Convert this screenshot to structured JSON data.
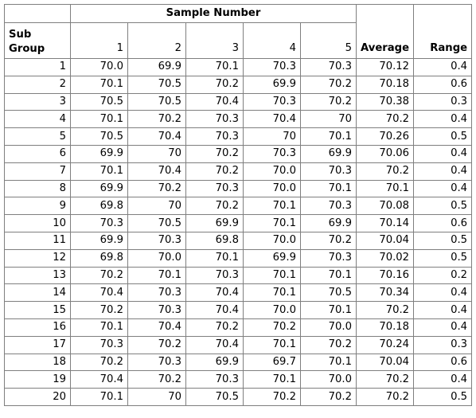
{
  "table": {
    "group_header": "Sample Number",
    "subgroup_header_line1": "Sub",
    "subgroup_header_line2": "Group",
    "sample_columns": [
      "1",
      "2",
      "3",
      "4",
      "5"
    ],
    "average_header": "Average",
    "range_header": "Range",
    "rows": [
      {
        "subgroup": "1",
        "samples": [
          "70.0",
          "69.9",
          "70.1",
          "70.3",
          "70.3"
        ],
        "average": "70.12",
        "range": "0.4"
      },
      {
        "subgroup": "2",
        "samples": [
          "70.1",
          "70.5",
          "70.2",
          "69.9",
          "70.2"
        ],
        "average": "70.18",
        "range": "0.6"
      },
      {
        "subgroup": "3",
        "samples": [
          "70.5",
          "70.5",
          "70.4",
          "70.3",
          "70.2"
        ],
        "average": "70.38",
        "range": "0.3"
      },
      {
        "subgroup": "4",
        "samples": [
          "70.1",
          "70.2",
          "70.3",
          "70.4",
          "70"
        ],
        "average": "70.2",
        "range": "0.4"
      },
      {
        "subgroup": "5",
        "samples": [
          "70.5",
          "70.4",
          "70.3",
          "70",
          "70.1"
        ],
        "average": "70.26",
        "range": "0.5"
      },
      {
        "subgroup": "6",
        "samples": [
          "69.9",
          "70",
          "70.2",
          "70.3",
          "69.9"
        ],
        "average": "70.06",
        "range": "0.4"
      },
      {
        "subgroup": "7",
        "samples": [
          "70.1",
          "70.4",
          "70.2",
          "70.0",
          "70.3"
        ],
        "average": "70.2",
        "range": "0.4"
      },
      {
        "subgroup": "8",
        "samples": [
          "69.9",
          "70.2",
          "70.3",
          "70.0",
          "70.1"
        ],
        "average": "70.1",
        "range": "0.4"
      },
      {
        "subgroup": "9",
        "samples": [
          "69.8",
          "70",
          "70.2",
          "70.1",
          "70.3"
        ],
        "average": "70.08",
        "range": "0.5"
      },
      {
        "subgroup": "10",
        "samples": [
          "70.3",
          "70.5",
          "69.9",
          "70.1",
          "69.9"
        ],
        "average": "70.14",
        "range": "0.6"
      },
      {
        "subgroup": "11",
        "samples": [
          "69.9",
          "70.3",
          "69.8",
          "70.0",
          "70.2"
        ],
        "average": "70.04",
        "range": "0.5"
      },
      {
        "subgroup": "12",
        "samples": [
          "69.8",
          "70.0",
          "70.1",
          "69.9",
          "70.3"
        ],
        "average": "70.02",
        "range": "0.5"
      },
      {
        "subgroup": "13",
        "samples": [
          "70.2",
          "70.1",
          "70.3",
          "70.1",
          "70.1"
        ],
        "average": "70.16",
        "range": "0.2"
      },
      {
        "subgroup": "14",
        "samples": [
          "70.4",
          "70.3",
          "70.4",
          "70.1",
          "70.5"
        ],
        "average": "70.34",
        "range": "0.4"
      },
      {
        "subgroup": "15",
        "samples": [
          "70.2",
          "70.3",
          "70.4",
          "70.0",
          "70.1"
        ],
        "average": "70.2",
        "range": "0.4"
      },
      {
        "subgroup": "16",
        "samples": [
          "70.1",
          "70.4",
          "70.2",
          "70.2",
          "70.0"
        ],
        "average": "70.18",
        "range": "0.4"
      },
      {
        "subgroup": "17",
        "samples": [
          "70.3",
          "70.2",
          "70.4",
          "70.1",
          "70.2"
        ],
        "average": "70.24",
        "range": "0.3"
      },
      {
        "subgroup": "18",
        "samples": [
          "70.2",
          "70.3",
          "69.9",
          "69.7",
          "70.1"
        ],
        "average": "70.04",
        "range": "0.6"
      },
      {
        "subgroup": "19",
        "samples": [
          "70.4",
          "70.2",
          "70.3",
          "70.1",
          "70.0"
        ],
        "average": "70.2",
        "range": "0.4"
      },
      {
        "subgroup": "20",
        "samples": [
          "70.1",
          "70",
          "70.5",
          "70.2",
          "70.2"
        ],
        "average": "70.2",
        "range": "0.5"
      }
    ]
  }
}
